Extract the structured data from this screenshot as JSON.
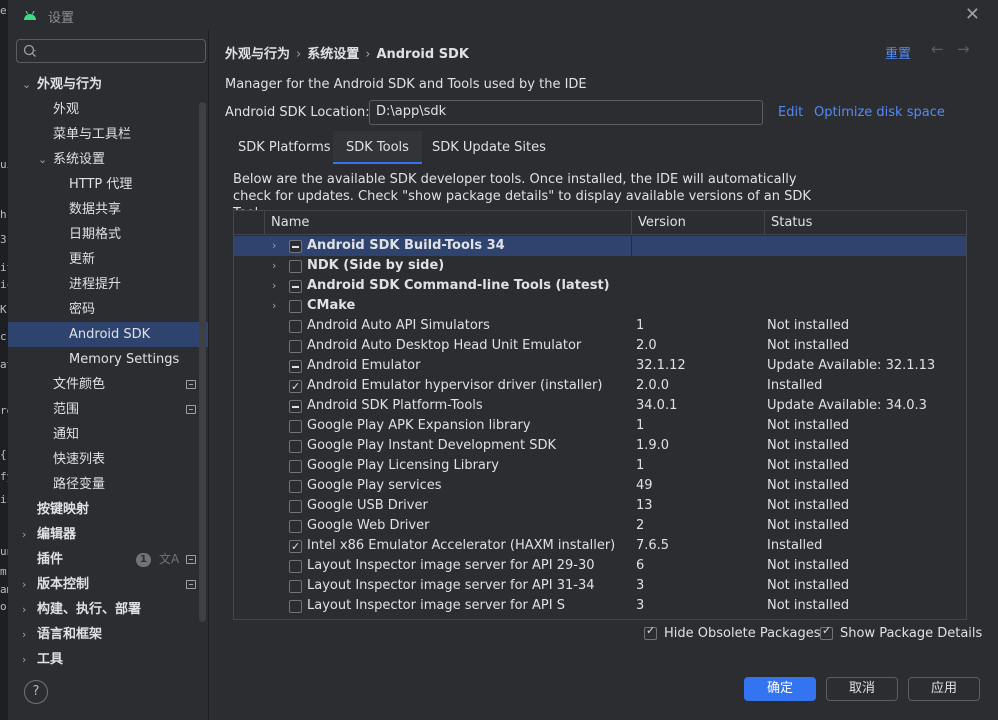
{
  "window": {
    "title": "设置",
    "close": "✕"
  },
  "bg_text": [
    "e",
    "ui",
    "h",
    "3",
    "it",
    "ic",
    "K",
    "c",
    "at",
    "re",
    "{",
    "fy",
    "is",
    "un",
    "m",
    "am",
    "or"
  ],
  "sidebar": {
    "search_placeholder": "",
    "items": [
      {
        "label": "外观与行为",
        "level": 0,
        "arrow": "⌄",
        "bold": true
      },
      {
        "label": "外观",
        "level": 1
      },
      {
        "label": "菜单与工具栏",
        "level": 1
      },
      {
        "label": "系统设置",
        "level": 1,
        "arrow": "⌄"
      },
      {
        "label": "HTTP 代理",
        "level": 2
      },
      {
        "label": "数据共享",
        "level": 2
      },
      {
        "label": "日期格式",
        "level": 2
      },
      {
        "label": "更新",
        "level": 2
      },
      {
        "label": "进程提升",
        "level": 2
      },
      {
        "label": "密码",
        "level": 2
      },
      {
        "label": "Android SDK",
        "level": 2,
        "selected": true
      },
      {
        "label": "Memory Settings",
        "level": 2
      },
      {
        "label": "文件颜色",
        "level": 1,
        "icon": true
      },
      {
        "label": "范围",
        "level": 1,
        "icon": true
      },
      {
        "label": "通知",
        "level": 1
      },
      {
        "label": "快速列表",
        "level": 1
      },
      {
        "label": "路径变量",
        "level": 1
      },
      {
        "label": "按键映射",
        "level": 0,
        "bold": true
      },
      {
        "label": "编辑器",
        "level": 0,
        "arrow": "›",
        "bold": true
      },
      {
        "label": "插件",
        "level": 0,
        "bold": true,
        "badge": "1",
        "trans": "文A",
        "icon": true
      },
      {
        "label": "版本控制",
        "level": 0,
        "arrow": "›",
        "bold": true,
        "icon": true
      },
      {
        "label": "构建、执行、部署",
        "level": 0,
        "arrow": "›",
        "bold": true
      },
      {
        "label": "语言和框架",
        "level": 0,
        "arrow": "›",
        "bold": true
      },
      {
        "label": "工具",
        "level": 0,
        "arrow": "›",
        "bold": true
      }
    ],
    "help": "?"
  },
  "header": {
    "breadcrumb": [
      "外观与行为",
      "系统设置",
      "Android SDK"
    ],
    "sep": "›",
    "reset": "重置",
    "back": "←",
    "forward": "→"
  },
  "sdk": {
    "description": "Manager for the Android SDK and Tools used by the IDE",
    "location_label": "Android SDK Location:",
    "location_value": "D:\\app\\sdk",
    "edit": "Edit",
    "optimize": "Optimize disk space",
    "tabs": [
      "SDK Platforms",
      "SDK Tools",
      "SDK Update Sites"
    ],
    "active_tab": 1,
    "panel_desc": "Below are the available SDK developer tools. Once installed, the IDE will automatically check for updates. Check \"show package details\" to display available versions of an SDK Tool.",
    "columns": [
      "Name",
      "Version",
      "Status"
    ],
    "rows": [
      {
        "name": "Android SDK Build-Tools 34",
        "version": "",
        "status": "",
        "group": true,
        "state": "partial",
        "selected": true
      },
      {
        "name": "NDK (Side by side)",
        "version": "",
        "status": "",
        "group": true,
        "state": "none"
      },
      {
        "name": "Android SDK Command-line Tools (latest)",
        "version": "",
        "status": "",
        "group": true,
        "state": "partial"
      },
      {
        "name": "CMake",
        "version": "",
        "status": "",
        "group": true,
        "state": "none"
      },
      {
        "name": "Android Auto API Simulators",
        "version": "1",
        "status": "Not installed",
        "state": "none"
      },
      {
        "name": "Android Auto Desktop Head Unit Emulator",
        "version": "2.0",
        "status": "Not installed",
        "state": "none"
      },
      {
        "name": "Android Emulator",
        "version": "32.1.12",
        "status": "Update Available: 32.1.13",
        "state": "partial"
      },
      {
        "name": "Android Emulator hypervisor driver (installer)",
        "version": "2.0.0",
        "status": "Installed",
        "state": "checked"
      },
      {
        "name": "Android SDK Platform-Tools",
        "version": "34.0.1",
        "status": "Update Available: 34.0.3",
        "state": "partial"
      },
      {
        "name": "Google Play APK Expansion library",
        "version": "1",
        "status": "Not installed",
        "state": "none"
      },
      {
        "name": "Google Play Instant Development SDK",
        "version": "1.9.0",
        "status": "Not installed",
        "state": "none"
      },
      {
        "name": "Google Play Licensing Library",
        "version": "1",
        "status": "Not installed",
        "state": "none"
      },
      {
        "name": "Google Play services",
        "version": "49",
        "status": "Not installed",
        "state": "none"
      },
      {
        "name": "Google USB Driver",
        "version": "13",
        "status": "Not installed",
        "state": "none"
      },
      {
        "name": "Google Web Driver",
        "version": "2",
        "status": "Not installed",
        "state": "none"
      },
      {
        "name": "Intel x86 Emulator Accelerator (HAXM installer)",
        "version": "7.6.5",
        "status": "Installed",
        "state": "checked"
      },
      {
        "name": "Layout Inspector image server for API 29-30",
        "version": "6",
        "status": "Not installed",
        "state": "none"
      },
      {
        "name": "Layout Inspector image server for API 31-34",
        "version": "3",
        "status": "Not installed",
        "state": "none"
      },
      {
        "name": "Layout Inspector image server for API S",
        "version": "3",
        "status": "Not installed",
        "state": "none"
      }
    ],
    "hide_obsolete": "Hide Obsolete Packages",
    "show_details": "Show Package Details"
  },
  "footer": {
    "ok": "确定",
    "cancel": "取消",
    "apply": "应用"
  },
  "colors": {
    "accent": "#3574f0",
    "selection": "#2e436e",
    "link": "#548af7",
    "bg": "#2b2d30"
  }
}
